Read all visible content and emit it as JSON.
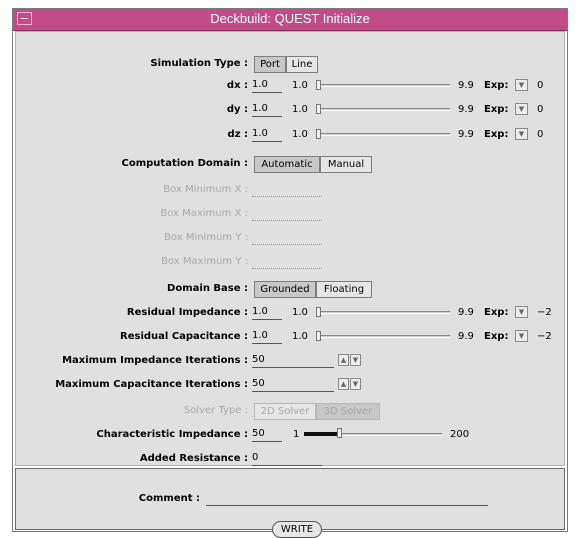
{
  "window": {
    "title": "Deckbuild: QUEST Initialize"
  },
  "simulation_type": {
    "label": "Simulation Type :",
    "options": [
      "Port",
      "Line"
    ],
    "selected": "Port"
  },
  "dx": {
    "label": "dx :",
    "value": "1.0",
    "min": "1.0",
    "max": "9.9",
    "slider_fraction": 0.0,
    "exp_label": "Exp:",
    "exp_value": "0"
  },
  "dy": {
    "label": "dy :",
    "value": "1.0",
    "min": "1.0",
    "max": "9.9",
    "slider_fraction": 0.0,
    "exp_label": "Exp:",
    "exp_value": "0"
  },
  "dz": {
    "label": "dz :",
    "value": "1.0",
    "min": "1.0",
    "max": "9.9",
    "slider_fraction": 0.0,
    "exp_label": "Exp:",
    "exp_value": "0"
  },
  "computation_domain": {
    "label": "Computation Domain :",
    "options": [
      "Automatic",
      "Manual"
    ],
    "selected": "Automatic"
  },
  "box_min_x": {
    "label": "Box Minimum X :",
    "value": ""
  },
  "box_max_x": {
    "label": "Box Maximum X :",
    "value": ""
  },
  "box_min_y": {
    "label": "Box Minimum Y :",
    "value": ""
  },
  "box_max_y": {
    "label": "Box Maximum Y :",
    "value": ""
  },
  "domain_base": {
    "label": "Domain Base :",
    "options": [
      "Grounded",
      "Floating"
    ],
    "selected": "Grounded"
  },
  "residual_impedance": {
    "label": "Residual Impedance :",
    "value": "1.0",
    "min": "1.0",
    "max": "9.9",
    "slider_fraction": 0.0,
    "exp_label": "Exp:",
    "exp_value": "−2"
  },
  "residual_capacitance": {
    "label": "Residual Capacitance :",
    "value": "1.0",
    "min": "1.0",
    "max": "9.9",
    "slider_fraction": 0.0,
    "exp_label": "Exp:",
    "exp_value": "−2"
  },
  "max_impedance_iterations": {
    "label": "Maximum Impedance Iterations :",
    "value": "50"
  },
  "max_capacitance_iterations": {
    "label": "Maximum Capacitance Iterations :",
    "value": "50"
  },
  "solver_type": {
    "label": "Solver Type :",
    "options": [
      "2D Solver",
      "3D Solver"
    ],
    "selected": "3D Solver"
  },
  "characteristic_impedance": {
    "label": "Characteristic Impedance :",
    "value": "50",
    "min": "1",
    "max": "200",
    "slider_fraction": 0.25
  },
  "added_resistance": {
    "label": "Added Resistance :",
    "value": "0"
  },
  "comment": {
    "label": "Comment :",
    "value": ""
  },
  "write_button": {
    "label": "WRITE"
  }
}
